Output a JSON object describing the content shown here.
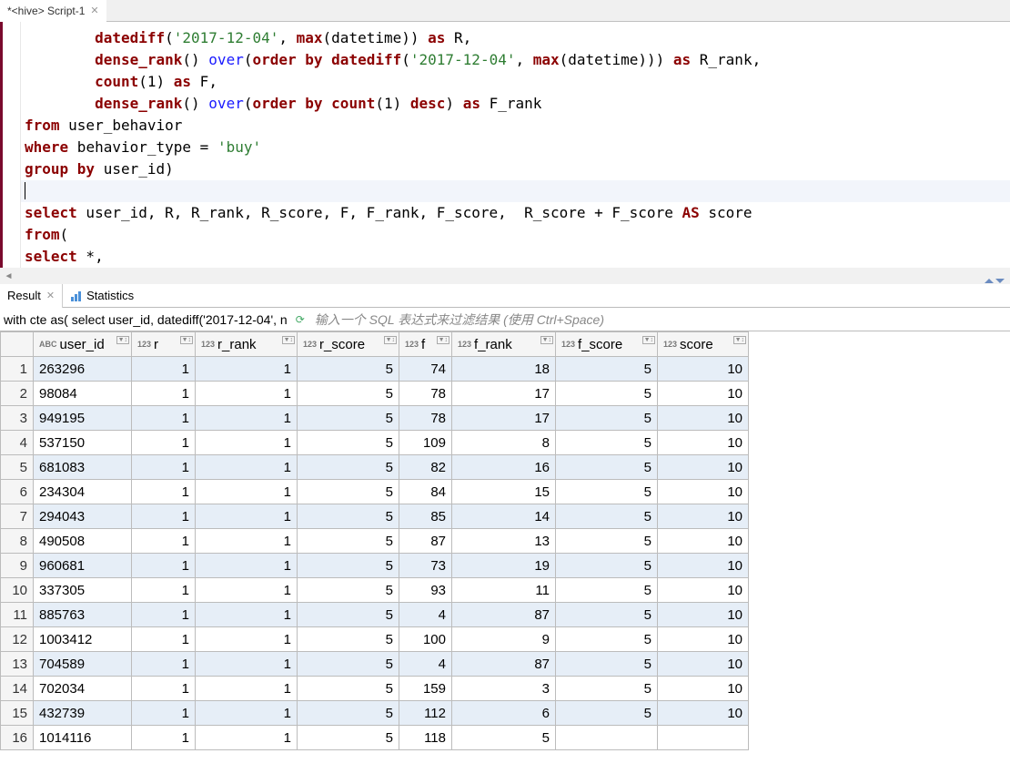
{
  "tab": {
    "title": "*<hive> Script-1"
  },
  "editor": {
    "lines": [
      {
        "indent": "        ",
        "tokens": [
          [
            "fn",
            "datediff"
          ],
          [
            "p",
            "("
          ],
          [
            "str",
            "'2017-12-04'"
          ],
          [
            "p",
            ", "
          ],
          [
            "fn",
            "max"
          ],
          [
            "p",
            "("
          ],
          [
            "id",
            "datetime"
          ],
          [
            "p",
            ")) "
          ],
          [
            "kw",
            "as"
          ],
          [
            "id",
            " R"
          ],
          [
            "p",
            ","
          ]
        ]
      },
      {
        "indent": "        ",
        "tokens": [
          [
            "fn",
            "dense_rank"
          ],
          [
            "p",
            "() "
          ],
          [
            "over",
            "over"
          ],
          [
            "p",
            "("
          ],
          [
            "kw",
            "order by"
          ],
          [
            "p",
            " "
          ],
          [
            "fn",
            "datediff"
          ],
          [
            "p",
            "("
          ],
          [
            "str",
            "'2017-12-04'"
          ],
          [
            "p",
            ", "
          ],
          [
            "fn",
            "max"
          ],
          [
            "p",
            "("
          ],
          [
            "id",
            "datetime"
          ],
          [
            "p",
            "))) "
          ],
          [
            "kw",
            "as"
          ],
          [
            "id",
            " R_rank"
          ],
          [
            "p",
            ","
          ]
        ]
      },
      {
        "indent": "        ",
        "tokens": [
          [
            "fn",
            "count"
          ],
          [
            "p",
            "("
          ],
          [
            "id",
            "1"
          ],
          [
            "p",
            ") "
          ],
          [
            "kw",
            "as"
          ],
          [
            "id",
            " F"
          ],
          [
            "p",
            ","
          ]
        ]
      },
      {
        "indent": "        ",
        "tokens": [
          [
            "fn",
            "dense_rank"
          ],
          [
            "p",
            "() "
          ],
          [
            "over",
            "over"
          ],
          [
            "p",
            "("
          ],
          [
            "kw",
            "order by"
          ],
          [
            "p",
            " "
          ],
          [
            "fn",
            "count"
          ],
          [
            "p",
            "("
          ],
          [
            "id",
            "1"
          ],
          [
            "p",
            ") "
          ],
          [
            "kw",
            "desc"
          ],
          [
            "p",
            ") "
          ],
          [
            "kw",
            "as"
          ],
          [
            "id",
            " F_rank"
          ]
        ]
      },
      {
        "indent": "",
        "tokens": [
          [
            "kw",
            "from"
          ],
          [
            "id",
            " user_behavior"
          ]
        ]
      },
      {
        "indent": "",
        "tokens": [
          [
            "kw",
            "where"
          ],
          [
            "id",
            " behavior_type "
          ],
          [
            "p",
            "= "
          ],
          [
            "str",
            "'buy'"
          ]
        ]
      },
      {
        "indent": "",
        "tokens": [
          [
            "kw",
            "group by"
          ],
          [
            "id",
            " user_id"
          ],
          [
            "p",
            ")"
          ]
        ]
      },
      {
        "indent": "",
        "tokens": [],
        "cursor": true
      },
      {
        "indent": "",
        "tokens": [
          [
            "kw",
            "select"
          ],
          [
            "id",
            " user_id, R, R_rank, R_score, F, F_rank, F_score,  R_score + F_score "
          ],
          [
            "kw",
            "AS"
          ],
          [
            "id",
            " score"
          ]
        ]
      },
      {
        "indent": "",
        "tokens": [
          [
            "kw",
            "from"
          ],
          [
            "p",
            "("
          ]
        ]
      },
      {
        "indent": "",
        "tokens": [
          [
            "kw",
            "select"
          ],
          [
            "id",
            " *"
          ],
          [
            "p",
            ","
          ]
        ]
      }
    ]
  },
  "results": {
    "tab_result": "Result",
    "tab_stats": "Statistics",
    "query_preview": "with cte as( select user_id, datediff('2017-12-04', n",
    "filter_placeholder": "输入一个 SQL 表达式来过滤结果 (使用 Ctrl+Space)"
  },
  "columns": [
    {
      "name": "user_id",
      "type": "ABC",
      "cls": "col-userid",
      "align": "txt"
    },
    {
      "name": "r",
      "type": "123",
      "cls": "col-r",
      "align": "num"
    },
    {
      "name": "r_rank",
      "type": "123",
      "cls": "col-rrank",
      "align": "num"
    },
    {
      "name": "r_score",
      "type": "123",
      "cls": "col-rscore",
      "align": "num"
    },
    {
      "name": "f",
      "type": "123",
      "cls": "col-f",
      "align": "num"
    },
    {
      "name": "f_rank",
      "type": "123",
      "cls": "col-frank",
      "align": "num"
    },
    {
      "name": "f_score",
      "type": "123",
      "cls": "col-fscore",
      "align": "num"
    },
    {
      "name": "score",
      "type": "123",
      "cls": "col-score",
      "align": "num"
    }
  ],
  "rows": [
    [
      "263296",
      "1",
      "1",
      "5",
      "74",
      "18",
      "5",
      "10"
    ],
    [
      "98084",
      "1",
      "1",
      "5",
      "78",
      "17",
      "5",
      "10"
    ],
    [
      "949195",
      "1",
      "1",
      "5",
      "78",
      "17",
      "5",
      "10"
    ],
    [
      "537150",
      "1",
      "1",
      "5",
      "109",
      "8",
      "5",
      "10"
    ],
    [
      "681083",
      "1",
      "1",
      "5",
      "82",
      "16",
      "5",
      "10"
    ],
    [
      "234304",
      "1",
      "1",
      "5",
      "84",
      "15",
      "5",
      "10"
    ],
    [
      "294043",
      "1",
      "1",
      "5",
      "85",
      "14",
      "5",
      "10"
    ],
    [
      "490508",
      "1",
      "1",
      "5",
      "87",
      "13",
      "5",
      "10"
    ],
    [
      "960681",
      "1",
      "1",
      "5",
      "73",
      "19",
      "5",
      "10"
    ],
    [
      "337305",
      "1",
      "1",
      "5",
      "93",
      "11",
      "5",
      "10"
    ],
    [
      "885763",
      "1",
      "1",
      "5",
      "4",
      "87",
      "5",
      "10"
    ],
    [
      "1003412",
      "1",
      "1",
      "5",
      "100",
      "9",
      "5",
      "10"
    ],
    [
      "704589",
      "1",
      "1",
      "5",
      "4",
      "87",
      "5",
      "10"
    ],
    [
      "702034",
      "1",
      "1",
      "5",
      "159",
      "3",
      "5",
      "10"
    ],
    [
      "432739",
      "1",
      "1",
      "5",
      "112",
      "6",
      "5",
      "10"
    ],
    [
      "1014116",
      "1",
      "1",
      "5",
      "118",
      "5",
      "",
      ""
    ]
  ]
}
